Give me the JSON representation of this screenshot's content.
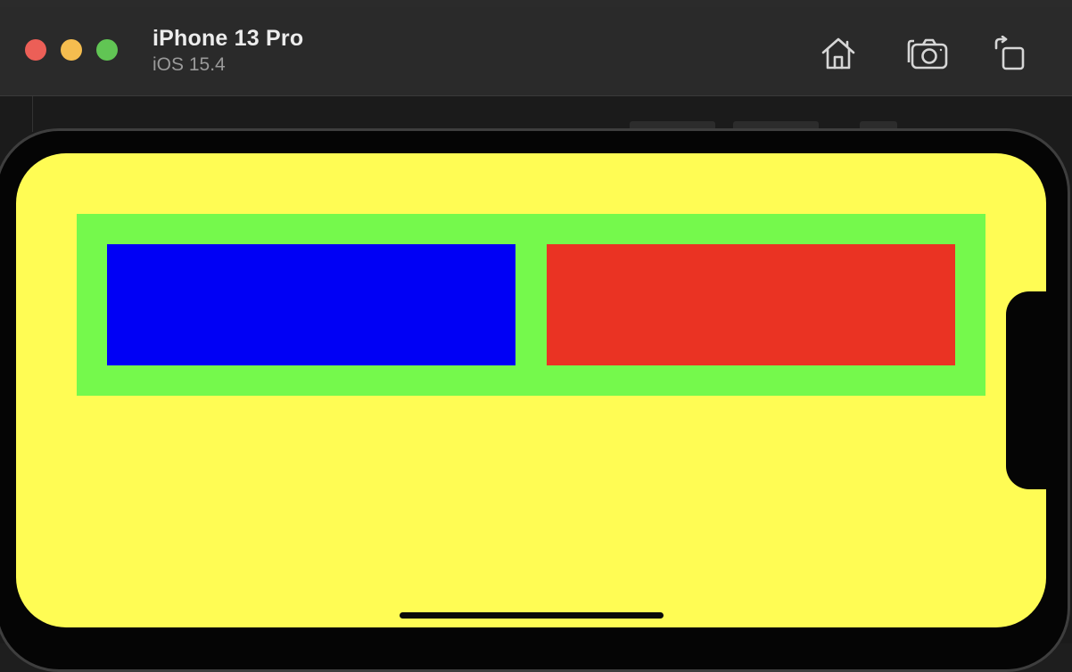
{
  "window": {
    "device_name": "iPhone 13 Pro",
    "os_version": "iOS 15.4"
  },
  "toolbar": {
    "buttons": [
      {
        "name": "home",
        "icon": "home-icon"
      },
      {
        "name": "screenshot",
        "icon": "camera-icon"
      },
      {
        "name": "rotate",
        "icon": "rotate-icon"
      }
    ]
  },
  "traffic_lights": {
    "close": "#ec5f57",
    "minimize": "#f5bd4f",
    "zoom": "#61c554"
  },
  "app": {
    "background": "#fffc54",
    "container_color": "#75f94c",
    "left_box_color": "#0000f5",
    "right_box_color": "#ea3323"
  }
}
